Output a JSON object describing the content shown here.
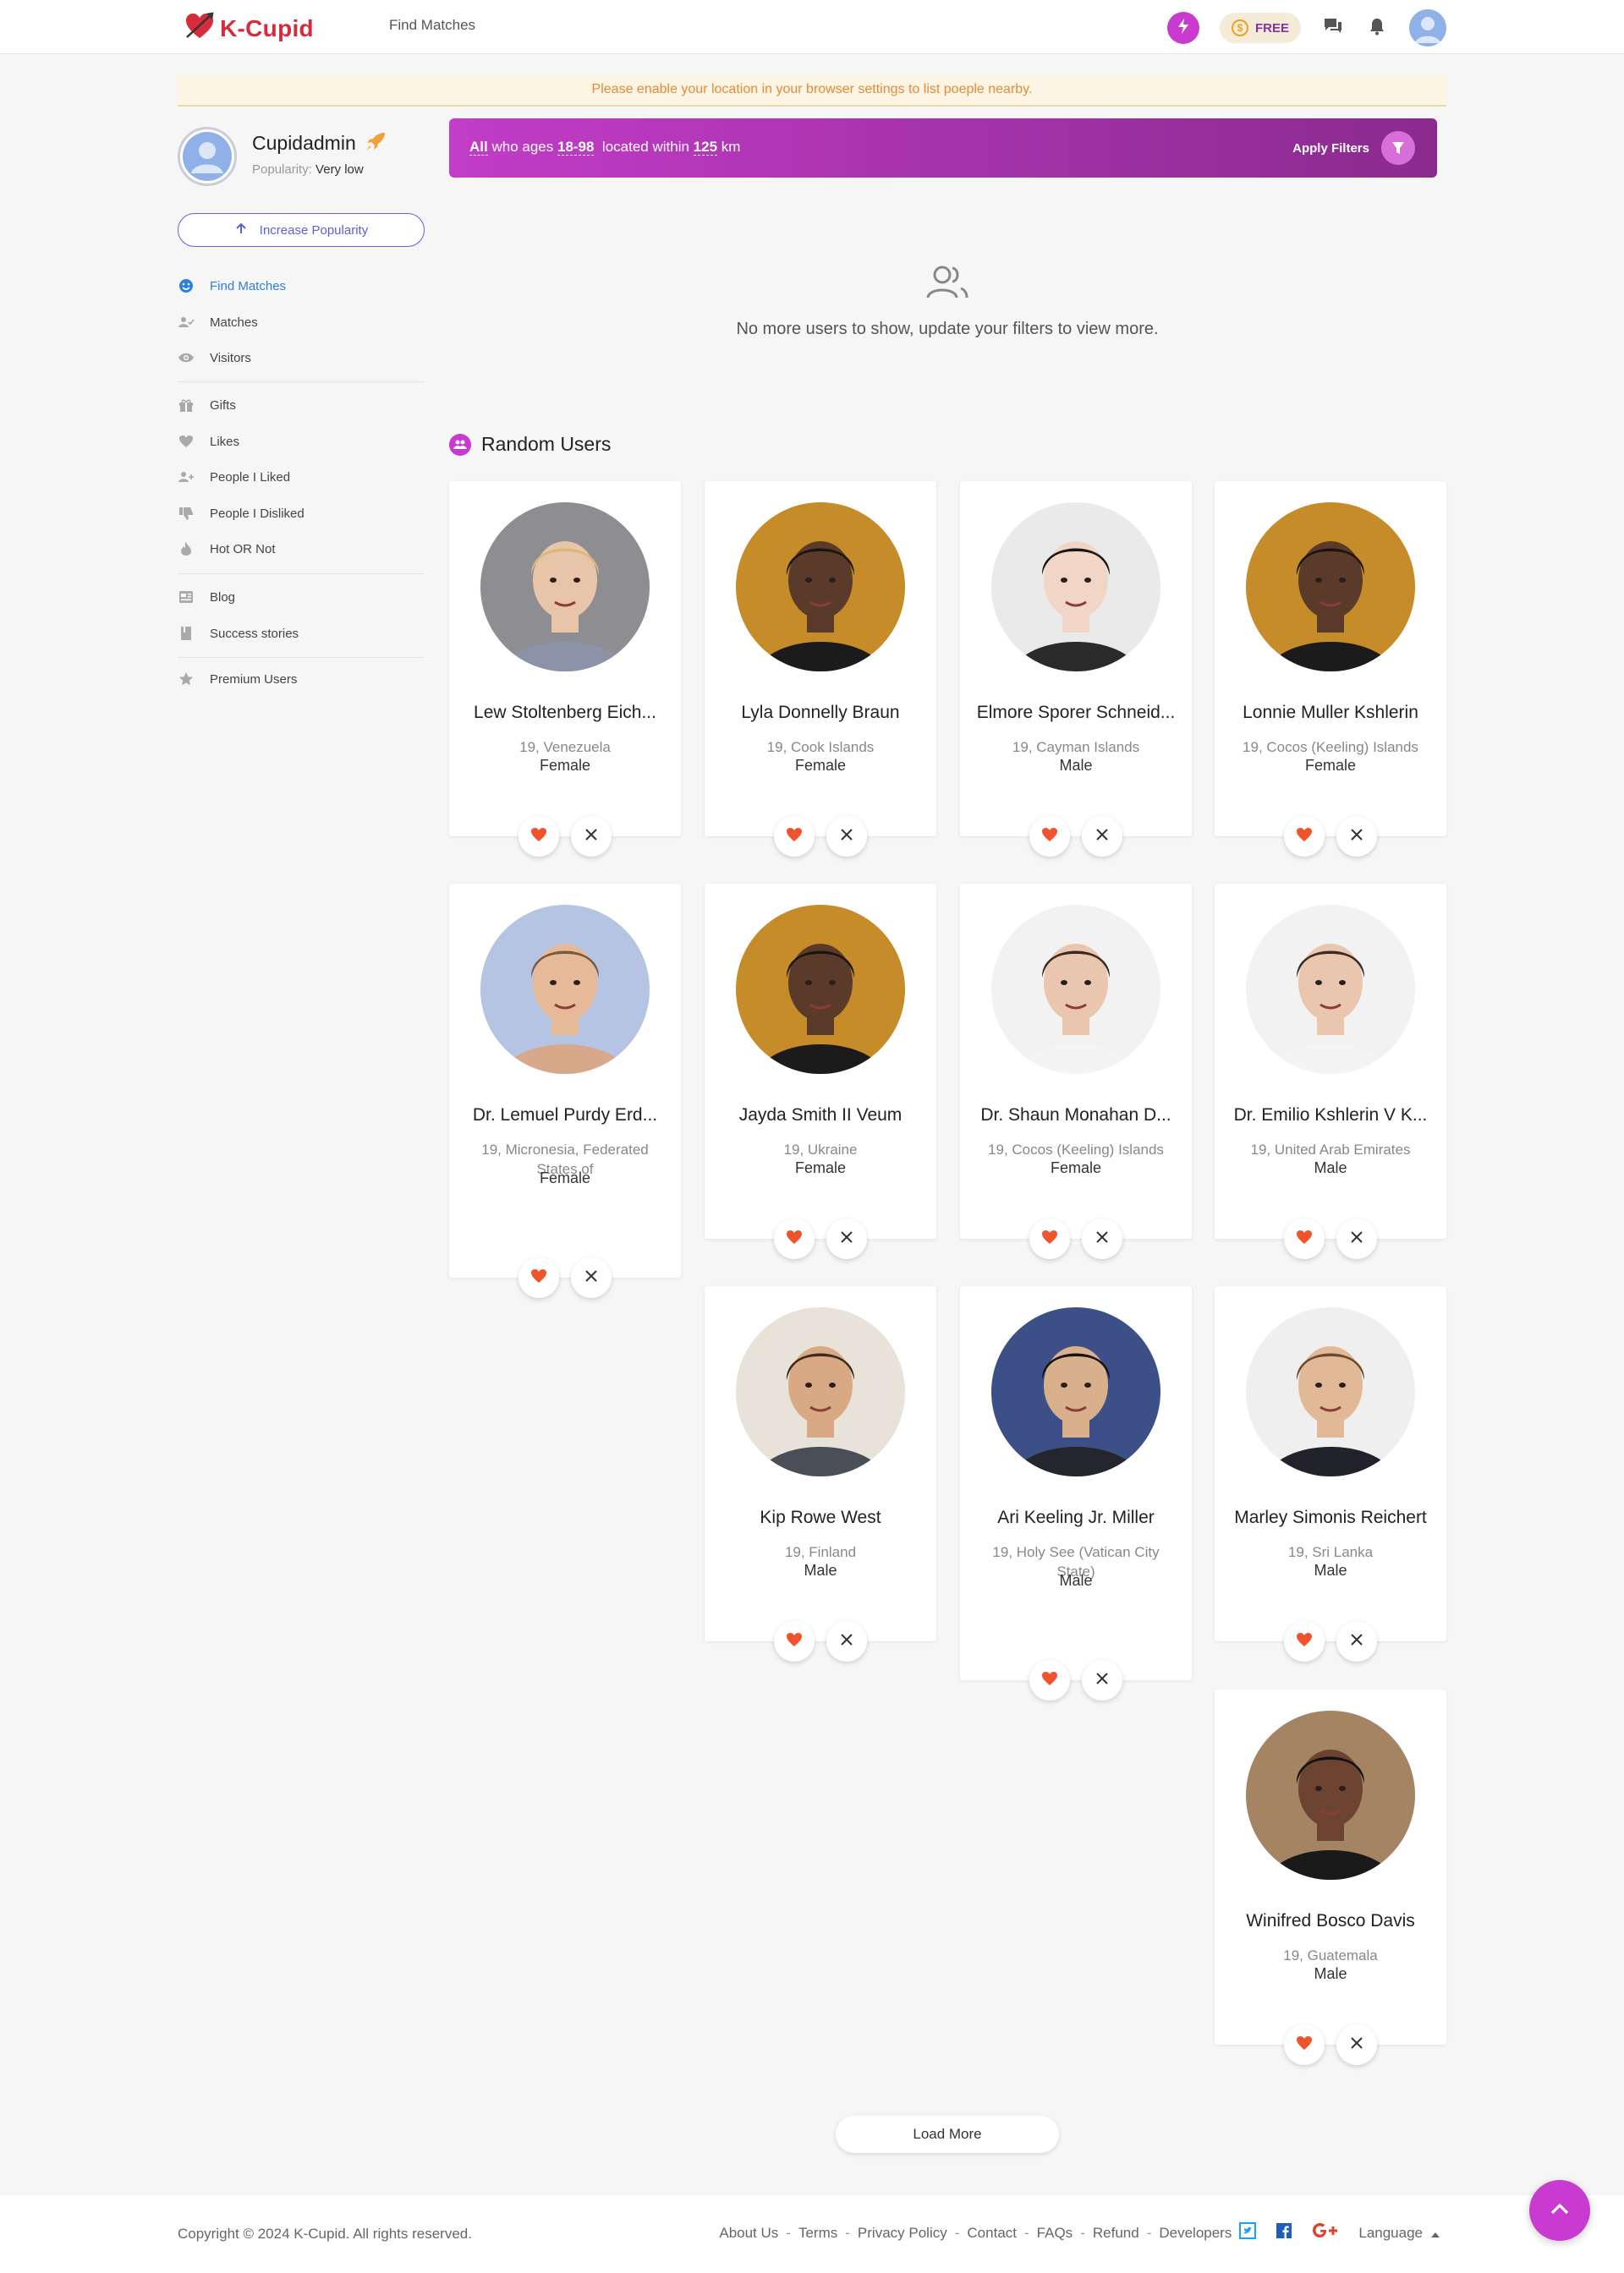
{
  "app": {
    "logo_text": "K-Cupid",
    "nav_link": "Find Matches",
    "plan_label": "FREE",
    "coin_symbol": "$"
  },
  "banner": {
    "location_notice": "Please enable your location in your browser settings to list poeple nearby."
  },
  "profile": {
    "name": "Cupidadmin",
    "popularity_label": "Popularity:",
    "popularity_value": "Very low",
    "increase_button": "Increase Popularity"
  },
  "sidebar": {
    "items": [
      {
        "label": "Find Matches",
        "icon": "find-matches-icon",
        "active": true
      },
      {
        "label": "Matches",
        "icon": "matches-icon"
      },
      {
        "label": "Visitors",
        "icon": "eye-icon"
      },
      {
        "label": "Gifts",
        "icon": "gift-icon"
      },
      {
        "label": "Likes",
        "icon": "heart-icon"
      },
      {
        "label": "People I Liked",
        "icon": "user-plus-icon"
      },
      {
        "label": "People I Disliked",
        "icon": "thumbs-down-icon"
      },
      {
        "label": "Hot OR Not",
        "icon": "flame-icon"
      },
      {
        "label": "Blog",
        "icon": "blog-icon"
      },
      {
        "label": "Success stories",
        "icon": "book-icon"
      },
      {
        "label": "Premium Users",
        "icon": "star-icon"
      }
    ]
  },
  "filter": {
    "who": "All",
    "ages_label": "who ages",
    "age_range": "18-98",
    "within_label": "located within",
    "distance": "125",
    "unit": "km",
    "apply_label": "Apply Filters"
  },
  "empty": {
    "message": "No more users to show, update your filters to view more."
  },
  "random": {
    "title": "Random Users"
  },
  "users": [
    {
      "name": "Lew Stoltenberg Eich...",
      "location": "19, Venezuela",
      "gender": "Female"
    },
    {
      "name": "Lyla Donnelly Braun",
      "location": "19, Cook Islands",
      "gender": "Female"
    },
    {
      "name": "Elmore Sporer Schneid...",
      "location": "19, Cayman Islands",
      "gender": "Male"
    },
    {
      "name": "Lonnie Muller Kshlerin",
      "location": "19, Cocos (Keeling) Islands",
      "gender": "Female"
    },
    {
      "name": "Dr. Lemuel Purdy Erd...",
      "location": "19, Micronesia, Federated States of",
      "gender": "Female"
    },
    {
      "name": "Jayda Smith II Veum",
      "location": "19, Ukraine",
      "gender": "Female"
    },
    {
      "name": "Dr. Shaun Monahan D...",
      "location": "19, Cocos (Keeling) Islands",
      "gender": "Female"
    },
    {
      "name": "Dr. Emilio Kshlerin V K...",
      "location": "19, United Arab Emirates",
      "gender": "Male"
    },
    {
      "name": "Kip Rowe West",
      "location": "19, Finland",
      "gender": "Male"
    },
    {
      "name": "Ari Keeling Jr. Miller",
      "location": "19, Holy See (Vatican City State)",
      "gender": "Male"
    },
    {
      "name": "Marley Simonis Reichert",
      "location": "19, Sri Lanka",
      "gender": "Male"
    },
    {
      "name": "Winifred Bosco Davis",
      "location": "19, Guatemala",
      "gender": "Male"
    }
  ],
  "load_more": "Load More",
  "footer": {
    "copyright": "Copyright © 2024 K-Cupid. All rights reserved.",
    "links": [
      "About Us",
      "Terms",
      "Privacy Policy",
      "Contact",
      "FAQs",
      "Refund",
      "Developers"
    ],
    "language": "Language"
  },
  "colors": {
    "brand": "#c83ad0",
    "logo": "#d62b3b",
    "link_active": "#2d7fe0",
    "like": "#f0542d"
  }
}
